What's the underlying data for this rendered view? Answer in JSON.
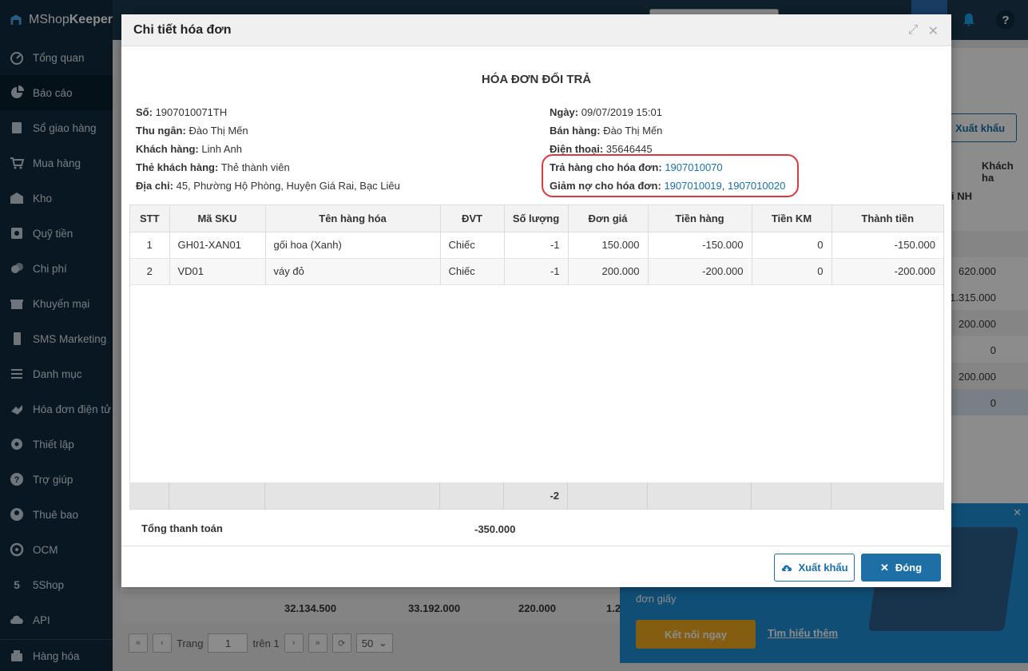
{
  "app": {
    "logo_text_light": "MShop",
    "logo_text_bold": "Keeper"
  },
  "sidebar": {
    "items": [
      {
        "label": "Tổng quan",
        "icon": "dashboard-icon"
      },
      {
        "label": "Báo cáo",
        "icon": "pie-chart-icon",
        "active": true
      },
      {
        "label": "Sổ giao hàng",
        "icon": "delivery-book-icon"
      },
      {
        "label": "Mua hàng",
        "icon": "cart-icon"
      },
      {
        "label": "Kho",
        "icon": "warehouse-icon"
      },
      {
        "label": "Quỹ tiền",
        "icon": "safe-icon"
      },
      {
        "label": "Chi phí",
        "icon": "coins-icon"
      },
      {
        "label": "Khuyến mại",
        "icon": "gift-icon"
      },
      {
        "label": "SMS Marketing",
        "icon": "phone-icon"
      },
      {
        "label": "Danh mục",
        "icon": "list-icon"
      },
      {
        "label": "Hóa đơn điện tử",
        "icon": "e-invoice-icon"
      },
      {
        "label": "Thiết lập",
        "icon": "gear-icon"
      },
      {
        "label": "Trợ giúp",
        "icon": "help-icon"
      },
      {
        "label": "Thuê bao",
        "icon": "user-icon"
      },
      {
        "label": "OCM",
        "icon": "ocm-icon"
      },
      {
        "label": "5Shop",
        "icon": "shop-icon"
      },
      {
        "label": "API",
        "icon": "cloud-upload-icon"
      }
    ],
    "bottom_item": {
      "label": "Hàng hóa",
      "icon": "goods-icon"
    }
  },
  "background": {
    "export_label": "Xuất khẩu",
    "col_header_customer": "Khách ha",
    "col_header_bank": "i NH",
    "amounts": [
      "620.000",
      "1.315.000",
      "200.000",
      "0",
      "200.000",
      "0"
    ],
    "footer_totals": [
      "32.134.500",
      "33.192.000",
      "220.000",
      "1.2"
    ],
    "pager": {
      "page_label": "Trang",
      "page_value": "1",
      "of_label": "trên 1",
      "page_size": "50"
    },
    "banner": {
      "text": "đơn giấy",
      "connect_button": "Kết nối ngay",
      "learn_more": "Tìm hiểu thêm"
    }
  },
  "modal": {
    "title": "Chi tiết hóa đơn",
    "invoice_title": "HÓA ĐƠN ĐỔI TRẢ",
    "left_info": [
      {
        "label": "Số:",
        "value": "1907010071TH"
      },
      {
        "label": "Thu ngân:",
        "value": "Đào Thị Mến"
      },
      {
        "label": "Khách hàng:",
        "value": "Linh Anh"
      },
      {
        "label": "Thẻ khách hàng:",
        "value": "Thẻ thành viên"
      },
      {
        "label": "Địa chỉ:",
        "value": "45, Phường Hộ Phòng, Huyện Giá Rai, Bạc Liêu"
      }
    ],
    "right_info": [
      {
        "label": "Ngày:",
        "value": "09/07/2019 15:01"
      },
      {
        "label": "Bán hàng:",
        "value": "Đào Thị Mến"
      },
      {
        "label": "Điện thoại:",
        "value": "35646445"
      }
    ],
    "return_for_label": "Trả hàng cho hóa đơn:",
    "return_for_invoice": "1907010070",
    "debt_reduce_label": "Giảm nợ cho hóa đơn:",
    "debt_reduce_invoices": [
      "1907010019",
      "1907010020"
    ],
    "table": {
      "headers": [
        "STT",
        "Mã SKU",
        "Tên hàng hóa",
        "ĐVT",
        "Số lượng",
        "Đơn giá",
        "Tiền hàng",
        "Tiền KM",
        "Thành tiền"
      ],
      "rows": [
        [
          "1",
          "GH01-XAN01",
          "gối hoa (Xanh)",
          "Chiếc",
          "-1",
          "150.000",
          "-150.000",
          "0",
          "-150.000"
        ],
        [
          "2",
          "VD01",
          "váy đỏ",
          "Chiếc",
          "-1",
          "200.000",
          "-200.000",
          "0",
          "-200.000"
        ]
      ],
      "footer_quantity": "-2"
    },
    "total_label": "Tổng thanh toán",
    "total_value": "-350.000",
    "export_button": "Xuất khẩu",
    "close_button": "Đóng"
  }
}
